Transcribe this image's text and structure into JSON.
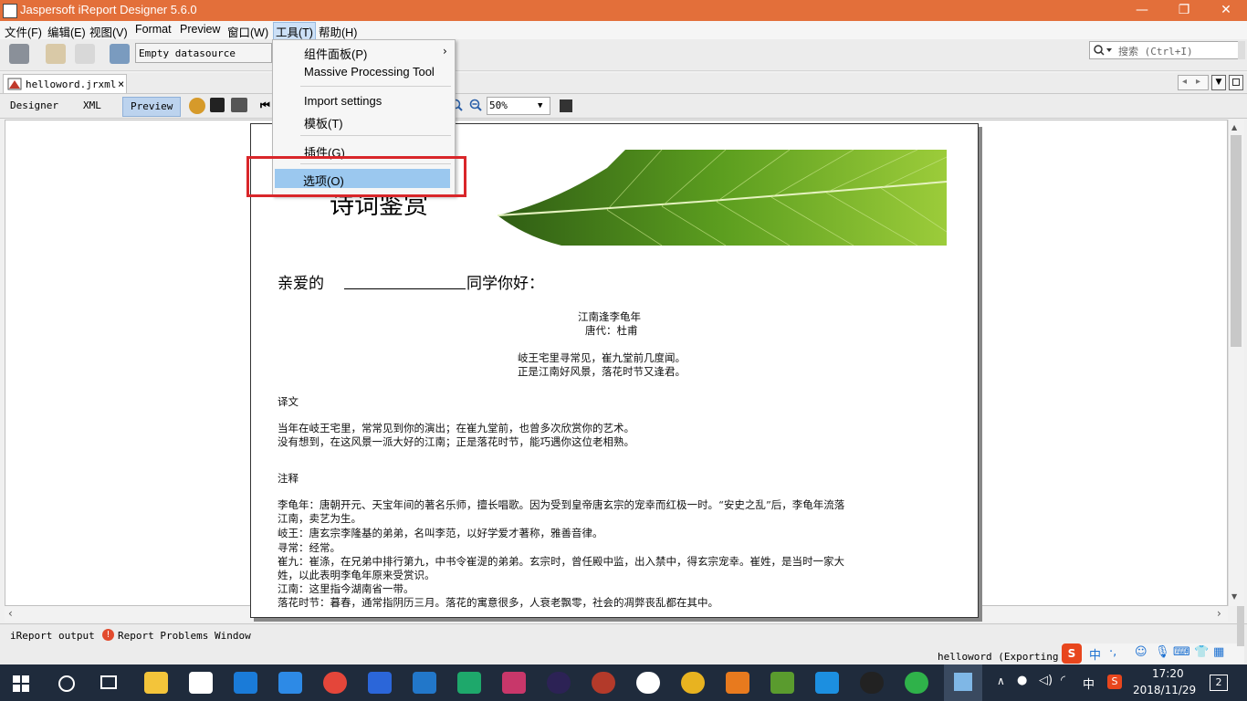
{
  "window": {
    "title": "Jaspersoft iReport Designer 5.6.0",
    "minimize": "—",
    "restore": "❐",
    "close": "✕"
  },
  "menubar": {
    "items": [
      "文件(F)",
      "编辑(E)",
      "视图(V)",
      "Format",
      "Preview",
      "窗口(W)",
      "工具(T)",
      "帮助(H)"
    ]
  },
  "toolbar": {
    "datasource": "Empty datasource",
    "search_placeholder": "搜索 (Ctrl+I)"
  },
  "doc_tab": {
    "label": "helloword.jrxml",
    "close": "×"
  },
  "subtoolbar": {
    "tabs": [
      "Designer",
      "XML",
      "Preview"
    ],
    "zoom": "50%"
  },
  "tools_menu": {
    "items": [
      "组件面板(P)",
      "Massive Processing Tool",
      "Import settings",
      "模板(T)",
      "插件(G)",
      "选项(O)"
    ],
    "highlighted": "选项(O)"
  },
  "report": {
    "title": "诗词鉴赏",
    "greeting_prefix": "亲爱的",
    "greeting_suffix": "同学你好：",
    "poem_title": "江南逢李龟年",
    "poem_author": "唐代：杜甫",
    "poem_line1": "岐王宅里寻常见，崔九堂前几度闻。",
    "poem_line2": "正是江南好风景，落花时节又逢君。",
    "translation_heading": "译文",
    "translation_line1": "当年在岐王宅里，常常见到你的演出；在崔九堂前，也曾多次欣赏你的艺术。",
    "translation_line2": "没有想到，在这风景一派大好的江南；正是落花时节，能巧遇你这位老相熟。",
    "notes_heading": "注释",
    "notes_line1": "李龟年：唐朝开元、天宝年间的著名乐师，擅长唱歌。因为受到皇帝唐玄宗的宠幸而红极一时。“安史之乱”后，李龟年流落",
    "notes_line2": "江南，卖艺为生。",
    "notes_line3": "岐王：唐玄宗李隆基的弟弟，名叫李范，以好学爱才著称，雅善音律。",
    "notes_line4": "寻常：经常。",
    "notes_line5": "崔九：崔涤，在兄弟中排行第九，中书令崔湜的弟弟。玄宗时，曾任殿中监，出入禁中，得玄宗宠幸。崔姓，是当时一家大",
    "notes_line6": "姓，以此表明李龟年原来受赏识。",
    "notes_line7": "江南：这里指今湖南省一带。",
    "notes_line8": "落花时节：暮春，通常指阴历三月。落花的寓意很多，人衰老飘零，社会的凋弊丧乱都在其中。"
  },
  "bottom": {
    "tab1": "iReport output",
    "tab2": "Report Problems Window",
    "status": "helloword (Exporting re"
  },
  "taskbar": {
    "time": "17:20",
    "date": "2018/11/29",
    "ime": "中",
    "notifications": "2"
  },
  "colors": {
    "titlebar": "#e36f3a",
    "highlight": "#9bc8ef",
    "redbox": "#d9262a",
    "taskbar": "#1f2b3c"
  }
}
